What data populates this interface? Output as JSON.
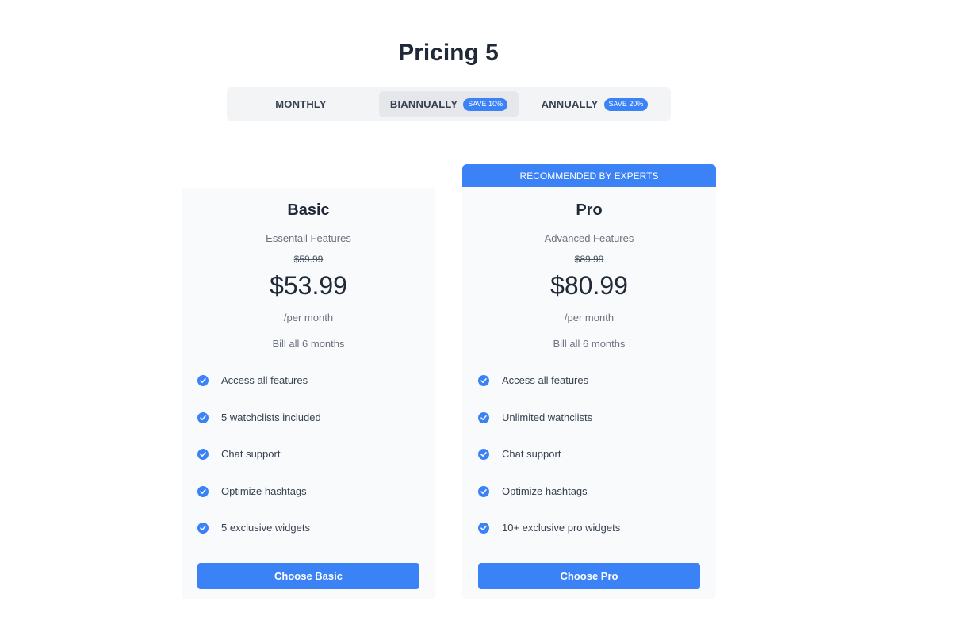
{
  "header": {
    "title": "Pricing 5"
  },
  "billing_tabs": [
    {
      "label": "MONTHLY",
      "badge": "",
      "active": false
    },
    {
      "label": "BIANNUALLY",
      "badge": "SAVE 10%",
      "active": true
    },
    {
      "label": "ANNUALLY",
      "badge": "SAVE 20%",
      "active": false
    }
  ],
  "colors": {
    "accent": "#3b82f6",
    "card_bg": "#f9fafb",
    "tabs_bg": "#f3f4f6",
    "active_tab_bg": "#e5e7eb"
  },
  "plans": [
    {
      "name": "Basic",
      "subtitle": "Essentail Features",
      "old_price": "$59.99",
      "price": "$53.99",
      "period": "/per month",
      "billing_note": "Bill all 6 months",
      "features": [
        "Access all features",
        "5 watchclists included",
        "Chat support",
        "Optimize hashtags",
        "5 exclusive widgets"
      ],
      "cta": "Choose Basic"
    },
    {
      "name": "Pro",
      "ribbon": "RECOMMENDED BY EXPERTS",
      "subtitle": "Advanced Features",
      "old_price": "$89.99",
      "price": "$80.99",
      "period": "/per month",
      "billing_note": "Bill all 6 months",
      "features": [
        "Access all features",
        "Unlimited wathclists",
        "Chat support",
        "Optimize hashtags",
        "10+ exclusive pro widgets"
      ],
      "cta": "Choose Pro"
    }
  ]
}
